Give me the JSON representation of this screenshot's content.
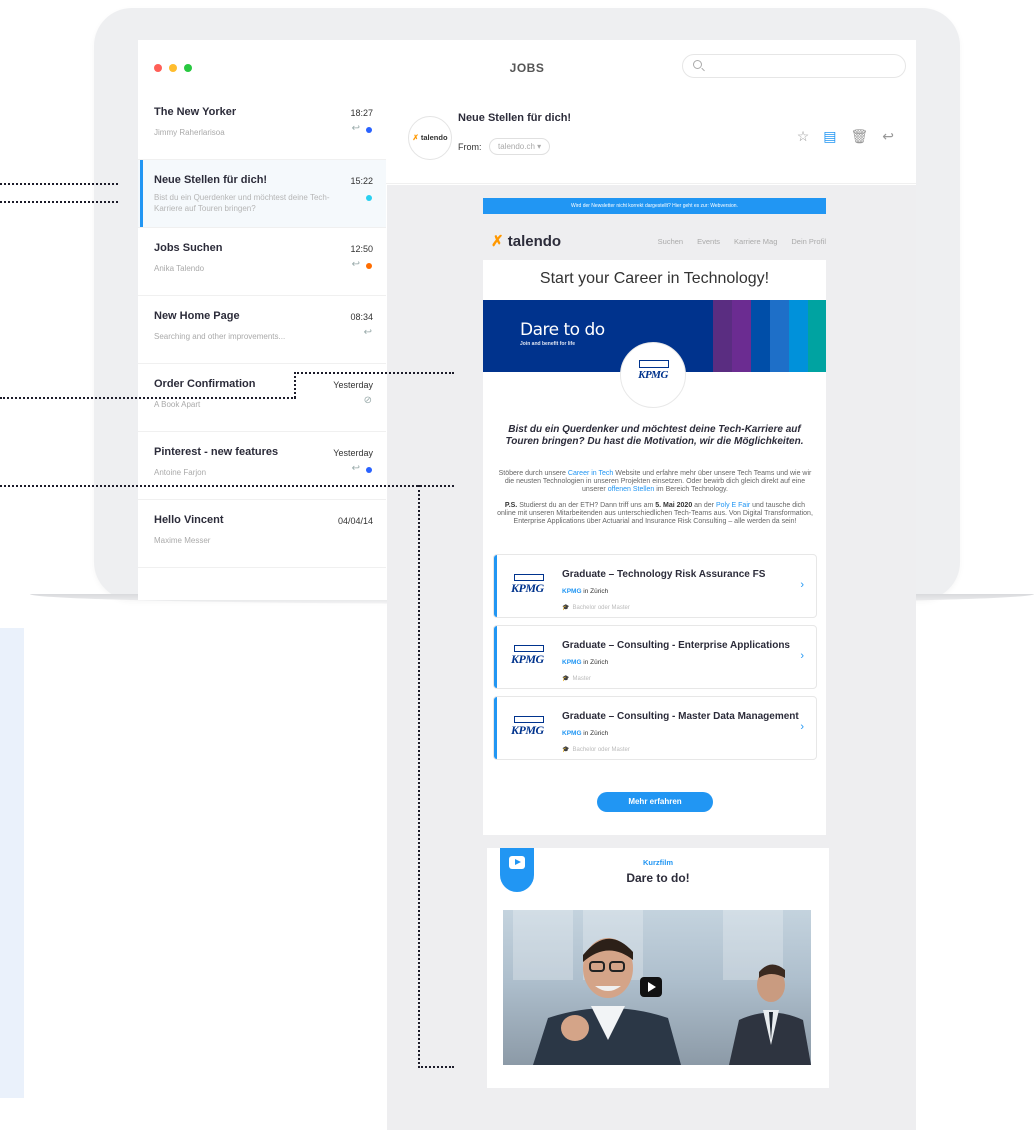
{
  "colors": {
    "accent": "#2196f3",
    "orange": "#ff9800",
    "kpmg_blue": "#00338d",
    "traffic_red": "#ff5f57",
    "traffic_yellow": "#ffbd2e",
    "traffic_green": "#28c840"
  },
  "window": {
    "title": "JOBS",
    "search_placeholder": ""
  },
  "inbox": [
    {
      "subject": "The New Yorker",
      "time": "18:27",
      "sender": "Jimmy Raherlarisoa",
      "icons": [
        "reply-icon"
      ],
      "dot_color": "#2962ff"
    },
    {
      "subject": "Neue Stellen für dich!",
      "time": "15:22",
      "preview": "Bist du ein Querdenker und möchtest deine Tech-Karriere auf Touren bringen?",
      "dot_color": "#29d0f0"
    },
    {
      "subject": "Jobs Suchen",
      "time": "12:50",
      "sender": "Anika Talendo",
      "icons": [
        "reply-icon"
      ],
      "dot_color": "#ff6d00"
    },
    {
      "subject": "New Home Page",
      "time": "08:34",
      "sender": "Searching and other improvements...",
      "icons": [
        "reply-icon"
      ]
    },
    {
      "subject": "Order Confirmation",
      "time": "Yesterday",
      "sender": "A Book Apart",
      "icons": [
        "attachment-icon"
      ]
    },
    {
      "subject": "Pinterest - new features",
      "time": "Yesterday",
      "sender": "Antoine Farjon",
      "icons": [
        "reply-icon"
      ],
      "dot_color": "#2962ff"
    },
    {
      "subject": "Hello Vincent",
      "time": "04/04/14",
      "sender": "Maxime Messer"
    }
  ],
  "reader": {
    "avatar_text": "talendo",
    "subject": "Neue Stellen für dich!",
    "from_label": "From:",
    "from_value": "talendo.ch",
    "actions": [
      "star-icon",
      "document-icon",
      "trash-icon",
      "reply-icon"
    ]
  },
  "newsletter": {
    "top_bar": "Wird der Newsletter nicht korrekt dargestellt? Hier geht es zur: Webversion.",
    "logo": "talendo",
    "nav": [
      "Suchen",
      "Events",
      "Karriere Mag",
      "Dein Profil"
    ],
    "headline": "Start your Career in Technology!",
    "banner_slogan": "Dare to do",
    "banner_sub": "Join and benefit for life",
    "banner_stripes": [
      "#5a2d81",
      "#6b2c91",
      "#004ea8",
      "#1e6fc8",
      "#0091da",
      "#00a3a1"
    ],
    "kpmg": "KPMG",
    "intro": "Bist du ein Querdenker und möchtest deine Tech-Karriere auf Touren bringen? Du hast die Motivation, wir die Möglichkeiten.",
    "p1_a": "Stöbere durch unsere ",
    "p1_link1": "Career in Tech",
    "p1_b": " Website und erfahre mehr über unsere Tech Teams und wie wir die neusten Technologien in unseren Projekten einsetzen. Oder bewirb dich gleich direkt auf eine unserer ",
    "p1_link2": "offenen Stellen",
    "p1_c": " im Bereich Technology.",
    "p2_ps": "P.S.",
    "p2_a": " Studierst du an der ETH? Dann triff uns am ",
    "p2_date": "5. Mai 2020",
    "p2_b": " an der ",
    "p2_link": "Poly E Fair",
    "p2_c": " und tausche dich online mit unseren Mitarbeitenden aus unterschiedlichen Tech-Teams aus. Von Digital Transformation, Enterprise Applications über Actuarial and Insurance Risk Consulting – alle werden da sein!",
    "jobs": [
      {
        "title": "Graduate – Technology Risk Assurance FS",
        "company": "KPMG",
        "location": " in Zürich",
        "degree": "Bachelor oder Master"
      },
      {
        "title": "Graduate – Consulting - Enterprise Applications",
        "company": "KPMG",
        "location": " in Zürich",
        "degree": "Master"
      },
      {
        "title": "Graduate – Consulting - Master Data Management",
        "company": "KPMG",
        "location": " in Zürich",
        "degree": "Bachelor oder Master"
      }
    ],
    "cta": "Mehr erfahren"
  },
  "video": {
    "kicker": "Kurzfilm",
    "title": "Dare to do!"
  }
}
